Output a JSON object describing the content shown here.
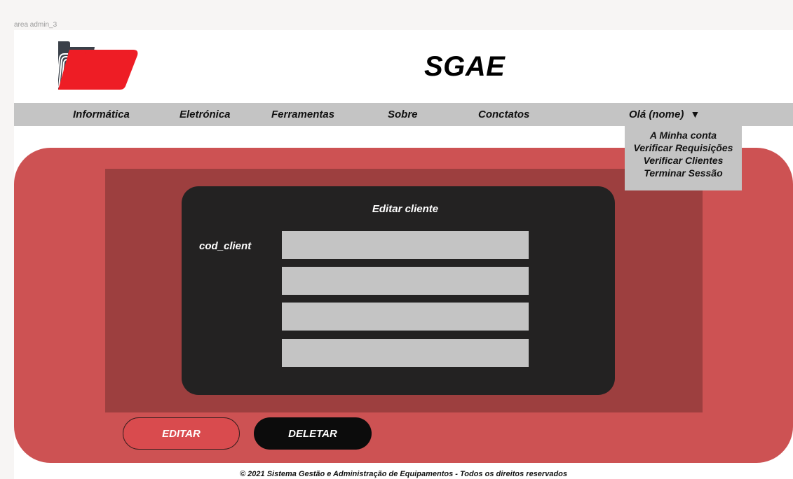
{
  "frame": {
    "label": "area admin_3"
  },
  "header": {
    "title": "SGAE"
  },
  "nav": {
    "items": [
      {
        "label": "Informática"
      },
      {
        "label": "Eletrónica"
      },
      {
        "label": "Ferramentas"
      },
      {
        "label": "Sobre"
      },
      {
        "label": "Conctatos"
      }
    ],
    "user_greeting": "Olá (nome)",
    "caret": "▼"
  },
  "user_menu": {
    "items": [
      {
        "label": "A Minha conta"
      },
      {
        "label": "Verificar Requisições"
      },
      {
        "label": "Verificar Clientes"
      },
      {
        "label": "Terminar Sessão"
      }
    ]
  },
  "form": {
    "title": "Editar cliente",
    "field_label": "cod_client",
    "fields": [
      {
        "value": ""
      },
      {
        "value": ""
      },
      {
        "value": ""
      },
      {
        "value": ""
      }
    ]
  },
  "actions": {
    "edit_label": "EDITAR",
    "delete_label": "DELETAR"
  },
  "footer": {
    "text": "© 2021 Sistema Gestão e Administração de Equipamentos - Todos os direitos reservados"
  },
  "colors": {
    "main_bg": "#cd5253",
    "inner_panel": "#9d3f3f",
    "card": "#232222",
    "nav_bar": "#c4c4c4",
    "edit_button": "#d94b4e",
    "delete_button": "#0c0c0c",
    "logo_red": "#ee1d25",
    "logo_dark": "#3a4049"
  },
  "icons": {
    "logo": "folder-logo-icon"
  }
}
